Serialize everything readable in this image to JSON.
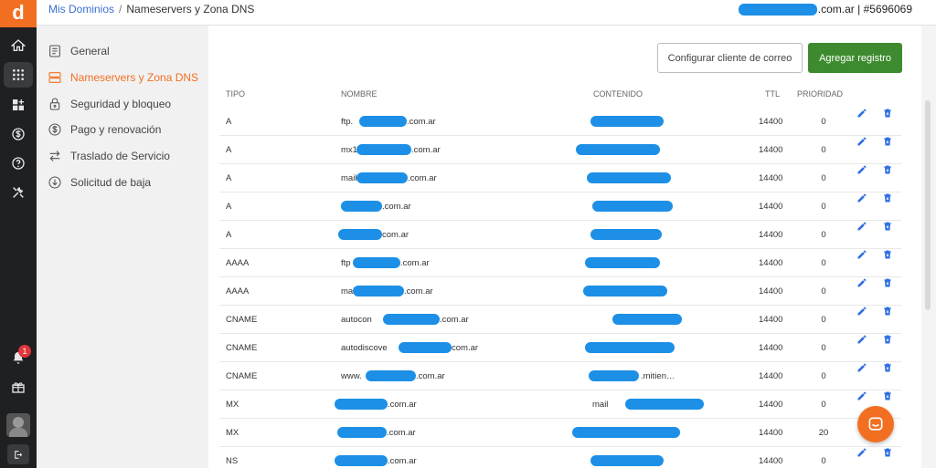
{
  "app": {
    "logo_letter": "d"
  },
  "breadcrumb": {
    "root": "Mis Dominios",
    "separator": "/",
    "current": "Nameservers y Zona DNS"
  },
  "account": {
    "domain_suffix": ".com.ar",
    "separator": "|",
    "id": "#5696069"
  },
  "notifications": {
    "count": "1"
  },
  "subnav": {
    "items": [
      {
        "label": "General",
        "icon": "document-icon"
      },
      {
        "label": "Nameservers y Zona DNS",
        "icon": "server-icon"
      },
      {
        "label": "Seguridad y bloqueo",
        "icon": "lock-icon"
      },
      {
        "label": "Pago y renovación",
        "icon": "dollar-icon"
      },
      {
        "label": "Traslado de Servicio",
        "icon": "transfer-icon"
      },
      {
        "label": "Solicitud de baja",
        "icon": "download-circle-icon"
      }
    ]
  },
  "actions": {
    "configure_mail": "Configurar cliente de correo",
    "add_record": "Agregar registro"
  },
  "table": {
    "headers": {
      "type": "TIPO",
      "name": "NOMBRE",
      "content": "CONTENIDO",
      "ttl": "TTL",
      "priority": "PRIORIDAD"
    },
    "rows": [
      {
        "type": "A",
        "name_prefix": "ftp.",
        "name_suffix": ".com.ar",
        "content_prefix": "",
        "content_suffix": "",
        "ttl": "14400",
        "priority": "0"
      },
      {
        "type": "A",
        "name_prefix": "mx1",
        "name_suffix": ".com.ar",
        "content_prefix": "",
        "content_suffix": "",
        "ttl": "14400",
        "priority": "0"
      },
      {
        "type": "A",
        "name_prefix": "mail.",
        "name_suffix": ".com.ar",
        "content_prefix": "",
        "content_suffix": "",
        "ttl": "14400",
        "priority": "0"
      },
      {
        "type": "A",
        "name_prefix": "",
        "name_suffix": ".com.ar",
        "content_prefix": "",
        "content_suffix": "",
        "ttl": "14400",
        "priority": "0"
      },
      {
        "type": "A",
        "name_prefix": "",
        "name_suffix": "com.ar",
        "content_prefix": "",
        "content_suffix": "",
        "ttl": "14400",
        "priority": "0"
      },
      {
        "type": "AAAA",
        "name_prefix": "ftp",
        "name_suffix": ".com.ar",
        "content_prefix": "",
        "content_suffix": "",
        "ttl": "14400",
        "priority": "0"
      },
      {
        "type": "AAAA",
        "name_prefix": "mai",
        "name_suffix": ".com.ar",
        "content_prefix": "",
        "content_suffix": "",
        "ttl": "14400",
        "priority": "0"
      },
      {
        "type": "CNAME",
        "name_prefix": "autocon",
        "name_suffix": ".com.ar",
        "content_prefix": "",
        "content_suffix": "",
        "ttl": "14400",
        "priority": "0"
      },
      {
        "type": "CNAME",
        "name_prefix": "autodiscove",
        "name_suffix": "com.ar",
        "content_prefix": "",
        "content_suffix": "",
        "ttl": "14400",
        "priority": "0"
      },
      {
        "type": "CNAME",
        "name_prefix": "www.",
        "name_suffix": ".com.ar",
        "content_prefix": "",
        "content_suffix": ".mitien…",
        "ttl": "14400",
        "priority": "0"
      },
      {
        "type": "MX",
        "name_prefix": "",
        "name_suffix": ".com.ar",
        "content_prefix": "mail",
        "content_suffix": "",
        "ttl": "14400",
        "priority": "0"
      },
      {
        "type": "MX",
        "name_prefix": "",
        "name_suffix": ".com.ar",
        "content_prefix": "",
        "content_suffix": "",
        "ttl": "14400",
        "priority": "20"
      },
      {
        "type": "NS",
        "name_prefix": "",
        "name_suffix": ".com.ar",
        "content_prefix": "",
        "content_suffix": "",
        "ttl": "14400",
        "priority": "0"
      }
    ]
  },
  "colors": {
    "brand": "#f26f21",
    "redaction": "#1d8fe6",
    "primary_button": "#3d8b2e",
    "action_icon": "#2f6fe0"
  }
}
